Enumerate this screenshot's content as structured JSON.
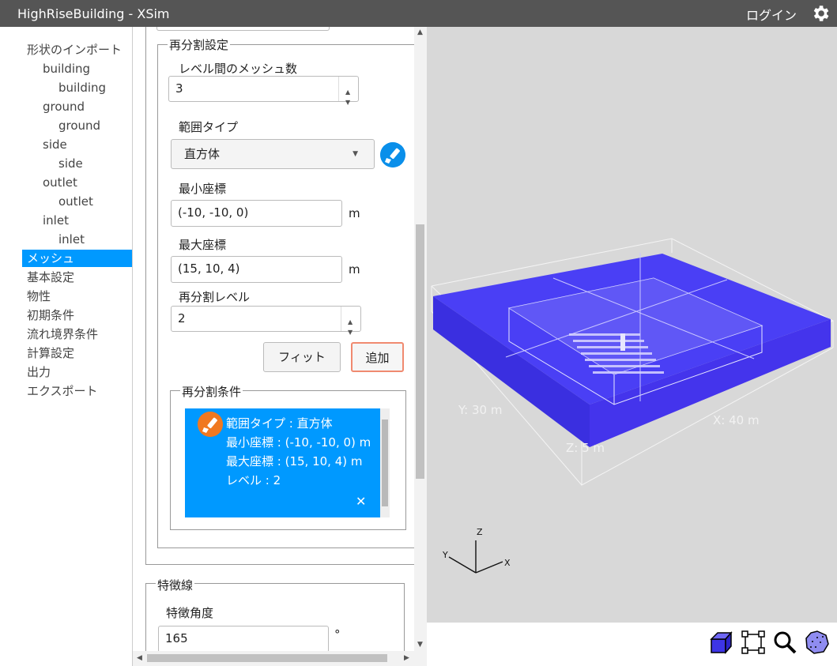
{
  "app": {
    "title": "HighRiseBuilding - XSim",
    "login": "ログイン"
  },
  "sidebar": {
    "items": [
      {
        "label": "形状のインポート"
      },
      {
        "label": "building"
      },
      {
        "label": "building"
      },
      {
        "label": "ground"
      },
      {
        "label": "ground"
      },
      {
        "label": "side"
      },
      {
        "label": "side"
      },
      {
        "label": "outlet"
      },
      {
        "label": "outlet"
      },
      {
        "label": "inlet"
      },
      {
        "label": "inlet"
      },
      {
        "label": "メッシュ"
      },
      {
        "label": "基本設定"
      },
      {
        "label": "物性"
      },
      {
        "label": "初期条件"
      },
      {
        "label": "流れ境界条件"
      },
      {
        "label": "計算設定"
      },
      {
        "label": "出力"
      },
      {
        "label": "エクスポート"
      }
    ],
    "active_index": 11
  },
  "refine": {
    "legend": "再分割設定",
    "mesh_between_levels_label": "レベル間のメッシュ数",
    "mesh_between_levels_value": "3",
    "range_type_label": "範囲タイプ",
    "range_type_value": "直方体",
    "min_coord_label": "最小座標",
    "min_coord_value": "(-10, -10, 0)",
    "min_unit": "m",
    "max_coord_label": "最大座標",
    "max_coord_value": "(15, 10, 4)",
    "max_unit": "m",
    "level_label": "再分割レベル",
    "level_value": "2",
    "fit_button": "フィット",
    "add_button": "追加",
    "conditions_legend": "再分割条件",
    "condition_card": {
      "line1": "範囲タイプ : 直方体",
      "line2": "最小座標 : (-10, -10, 0) m",
      "line3": "最大座標 : (15, 10, 4) m",
      "line4": "レベル : 2",
      "close": "✕"
    }
  },
  "feature": {
    "legend": "特徴線",
    "angle_label": "特徴角度",
    "angle_value": "165",
    "angle_unit": "°"
  },
  "viewport": {
    "dim_x": "X: 40 m",
    "dim_y": "Y: 30 m",
    "dim_z": "Z: 5 m",
    "axis_x": "X",
    "axis_y": "Y",
    "axis_z": "Z",
    "mesh_color": "#4a3ff5"
  },
  "toolbar": {
    "icons": [
      "cube-view-icon",
      "fit-frame-icon",
      "zoom-icon",
      "sphere-icon"
    ]
  }
}
